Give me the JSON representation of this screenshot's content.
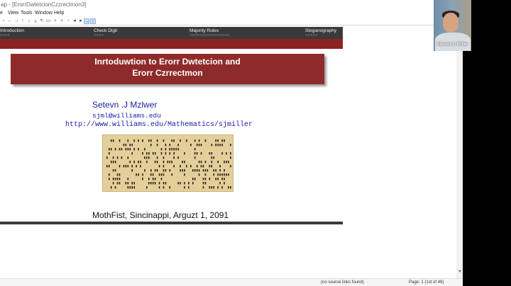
{
  "window": {
    "title": "ap - [ErorrDwtetcionCzzrectmon3]",
    "minimize_glyph": "–"
  },
  "menu": [
    "e",
    "View",
    "Tools",
    "Window",
    "Help"
  ],
  "toolbar_icons": [
    "page-icon",
    "left-arrow-icon",
    "right-arrow-icon",
    "up-arrow-icon",
    "down-arrow-icon",
    "down-bar-icon",
    "first-page-icon",
    "fit-page-icon",
    "search-icon",
    "zoom-in-icon",
    "zoom-out-icon",
    "back-icon",
    "forward-icon",
    "fit-width-icon",
    "fit-height-icon"
  ],
  "slide": {
    "nav": {
      "sections": [
        "Introduction",
        "Check Digit",
        "Majority Rules",
        "Steganography"
      ],
      "dots": [
        "○○○○",
        "○○○○",
        "○○○○○○○○○○○○○○○○",
        "○○○○○"
      ]
    },
    "title_line1": "Inrtoduwtion to Erorr Dwtetcion and",
    "title_line2": "Erorr Czrrectmon",
    "author": "Setevn .J Mzlwer",
    "email": "sjml@williams.edu",
    "url": "http://www.williams.edu/Mathematics/sjmiller",
    "footer": "MothFist, Sincinappi, Arguzt 1, 2091",
    "image": "punched-card"
  },
  "status": {
    "source_links": "(no source links found)",
    "page_label": "Page:",
    "page_value": "1",
    "page_total": "(1st of 49)"
  },
  "webcam": {
    "name": "Steven J. Miller"
  },
  "colors": {
    "nav_bg": "#3a3a3a",
    "title_red": "#8f2a2a",
    "link_blue": "#1a1aa8",
    "card_tan": "#e4cf9b"
  }
}
